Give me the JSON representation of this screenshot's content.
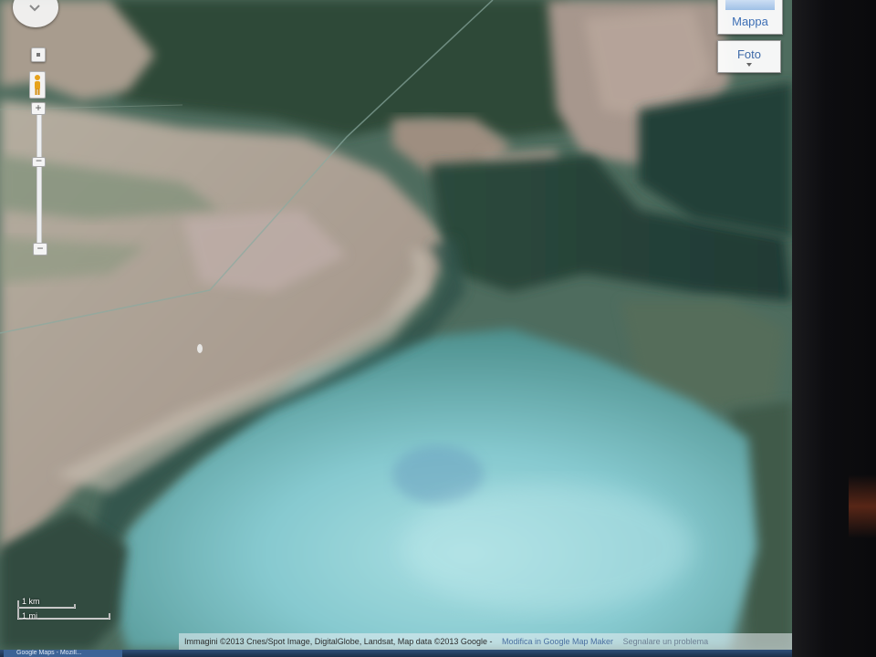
{
  "map": {
    "view": "satellite",
    "colors": {
      "lagoon": "#7ec4c9",
      "shallow_water": "#4f8f87",
      "land": "#b9a89b",
      "vegetation": "#2f4a37",
      "mudflat": "#6d8a73"
    }
  },
  "controls": {
    "pan_icon": "chevron-down-icon",
    "zoom_in": "+",
    "zoom_out": "−",
    "pegman_icon": "pegman-icon"
  },
  "map_type": {
    "mappa": "Mappa",
    "foto": "Foto"
  },
  "scale": {
    "km": "1 km",
    "mi": "1 mi"
  },
  "attribution": {
    "text": "Immagini ©2013 Cnes/Spot Image, DigitalGlobe, Landsat, Map data ©2013 Google -",
    "edit_link": "Modifica in Google Map Maker",
    "report_link": "Segnalare un problema"
  },
  "taskbar": {
    "item": "Google Maps - Mozill..."
  }
}
